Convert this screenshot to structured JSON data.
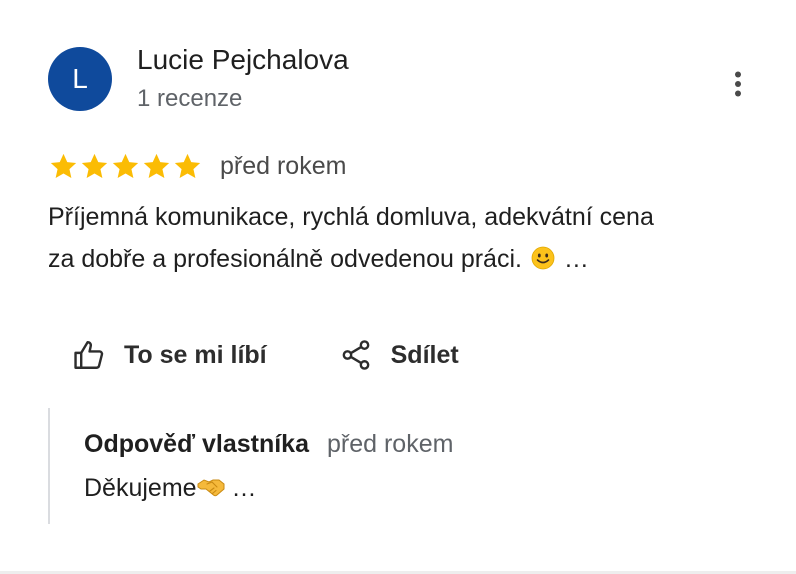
{
  "reviewer": {
    "avatar_letter": "L",
    "avatar_color": "#0f4a9c",
    "name": "Lucie Pejchalova",
    "review_count": "1 recenze"
  },
  "more_options_icon": "more-vert-icon",
  "review": {
    "rating": 5,
    "rating_max": 5,
    "star_color": "#fbbc04",
    "time": "před rokem",
    "text_line1": "Příjemná komunikace, rychlá domluva, adekvátní cena",
    "text_line2_start": "za dobře a profesionálně odvedenou práci.",
    "text_emoji": "slightly-smiling-face-emoji",
    "more_label": "…"
  },
  "actions": {
    "like_label": "To se mi líbí",
    "like_icon": "thumbs-up-icon",
    "share_label": "Sdílet",
    "share_icon": "share-icon"
  },
  "owner_reply": {
    "title": "Odpověď vlastníka",
    "time": "před rokem",
    "text": "Děkujeme",
    "text_emoji": "handshake-emoji",
    "more_label": "…"
  }
}
